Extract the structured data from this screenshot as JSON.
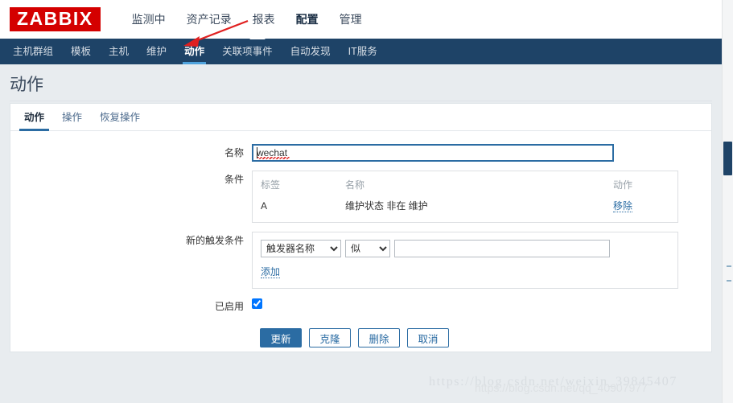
{
  "brand": {
    "logo_text": "ZABBIX",
    "logo_bg": "#d40000"
  },
  "top_nav": {
    "items": [
      {
        "label": "监测中",
        "selected": false
      },
      {
        "label": "资产记录",
        "selected": false
      },
      {
        "label": "报表",
        "selected": false
      },
      {
        "label": "配置",
        "selected": true
      },
      {
        "label": "管理",
        "selected": false
      }
    ]
  },
  "sub_nav": {
    "items": [
      {
        "label": "主机群组",
        "selected": false
      },
      {
        "label": "模板",
        "selected": false
      },
      {
        "label": "主机",
        "selected": false
      },
      {
        "label": "维护",
        "selected": false
      },
      {
        "label": "动作",
        "selected": true
      },
      {
        "label": "关联项事件",
        "selected": false
      },
      {
        "label": "自动发现",
        "selected": false
      },
      {
        "label": "IT服务",
        "selected": false
      }
    ]
  },
  "page": {
    "title": "动作"
  },
  "tabs": [
    {
      "label": "动作",
      "selected": true
    },
    {
      "label": "操作",
      "selected": false
    },
    {
      "label": "恢复操作",
      "selected": false
    }
  ],
  "form": {
    "name": {
      "label": "名称",
      "value": "wechat",
      "placeholder": ""
    },
    "conditions": {
      "label": "条件",
      "headers": {
        "label": "标签",
        "name": "名称",
        "action": "动作"
      },
      "rows": [
        {
          "label": "A",
          "name": "维护状态 非在 维护",
          "action": "移除"
        }
      ]
    },
    "new_condition": {
      "label": "新的触发条件",
      "type_select": {
        "value": "触发器名称",
        "options": [
          "触发器名称"
        ]
      },
      "operator_select": {
        "value": "似",
        "options": [
          "似"
        ]
      },
      "value_input": {
        "value": "",
        "placeholder": ""
      },
      "add_link": "添加"
    },
    "enabled": {
      "label": "已启用",
      "checked": true
    }
  },
  "buttons": [
    {
      "label": "更新",
      "style": "primary"
    },
    {
      "label": "克隆",
      "style": "secondary"
    },
    {
      "label": "删除",
      "style": "secondary"
    },
    {
      "label": "取消",
      "style": "secondary"
    }
  ],
  "watermarks": {
    "primary": "https://blog.csdn.net/weixin_39845407",
    "secondary": "https://blog.csdn.net/qq_40907977"
  },
  "annotation": {
    "arrow_color": "#e02020"
  },
  "colors": {
    "sub_nav_bg": "#1e4367",
    "accent": "#2b6ca3",
    "page_bg": "#e8ecef"
  }
}
